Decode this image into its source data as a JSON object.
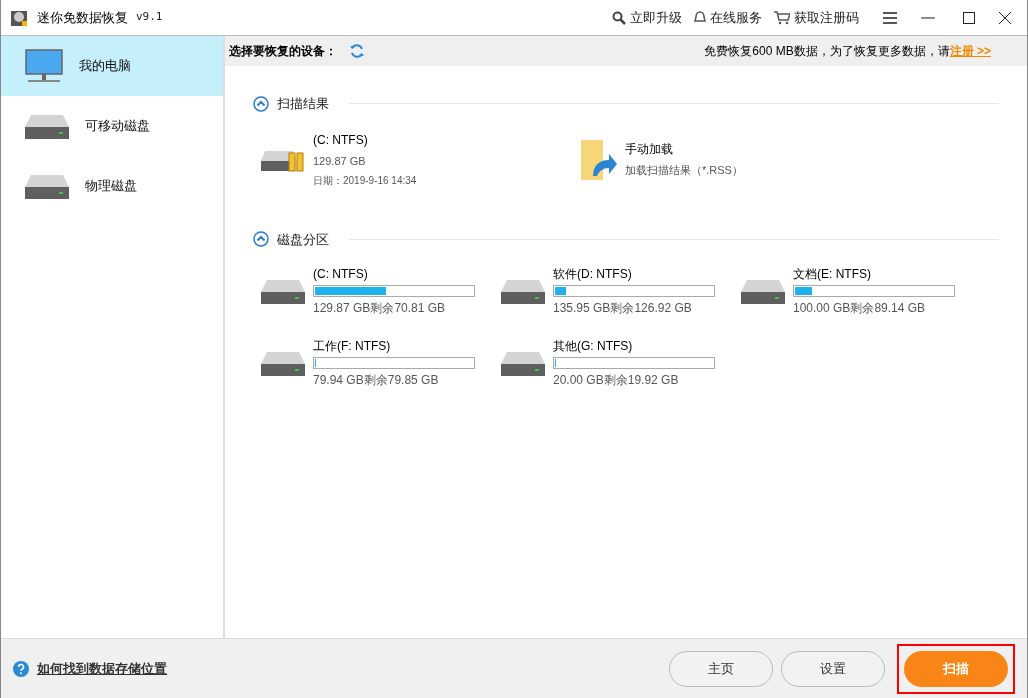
{
  "window": {
    "title": "迷你免数据恢复",
    "version": "v9.1",
    "actions": [
      {
        "kind": "key",
        "label": "立即升级"
      },
      {
        "kind": "headset",
        "label": "在线服务"
      },
      {
        "kind": "cart",
        "label": "获取注册码"
      }
    ]
  },
  "sidebar": {
    "items": [
      {
        "kind": "monitor",
        "label": "我的电脑",
        "selected": true
      },
      {
        "kind": "removable",
        "label": "可移动磁盘",
        "selected": false
      },
      {
        "kind": "physical",
        "label": "物理磁盘",
        "selected": false
      }
    ]
  },
  "header": {
    "label": "选择要恢复的设备：",
    "notice": "免费恢复600 MB数据，为了恢复更多数据，请",
    "link": "注册 >>"
  },
  "scan_results": {
    "title": "扫描结果",
    "expanded": true,
    "items": [
      {
        "kind": "drive",
        "name": "(C: NTFS)",
        "size": "129.87 GB",
        "date": "日期：2019-9-16 14:34"
      },
      {
        "kind": "load",
        "name": "手动加载",
        "size": "加载扫描结果（*.RSS）"
      }
    ]
  },
  "partitions": {
    "title": "磁盘分区",
    "expanded": true,
    "items": [
      {
        "name": "(C: NTFS)",
        "level": 0.45,
        "info": "129.87 GB剩余70.81 GB"
      },
      {
        "name": "软件(D: NTFS)",
        "level": 0.07,
        "info": "135.95 GB剩余126.92 GB"
      },
      {
        "name": "文档(E: NTFS)",
        "level": 0.11,
        "info": "100.00 GB剩余89.14 GB"
      },
      {
        "name": "工作(F: NTFS)",
        "level": 0.001,
        "info": "79.94 GB剩余79.85 GB"
      },
      {
        "name": "其他(G: NTFS)",
        "level": 0.004,
        "info": "20.00 GB剩余19.92 GB"
      }
    ]
  },
  "footer": {
    "help": "如何找到数据存储位置",
    "buttons": [
      {
        "label": "主页",
        "primary": false
      },
      {
        "label": "设置",
        "primary": false
      },
      {
        "label": "扫描",
        "primary": true,
        "highlighted": true
      }
    ]
  }
}
